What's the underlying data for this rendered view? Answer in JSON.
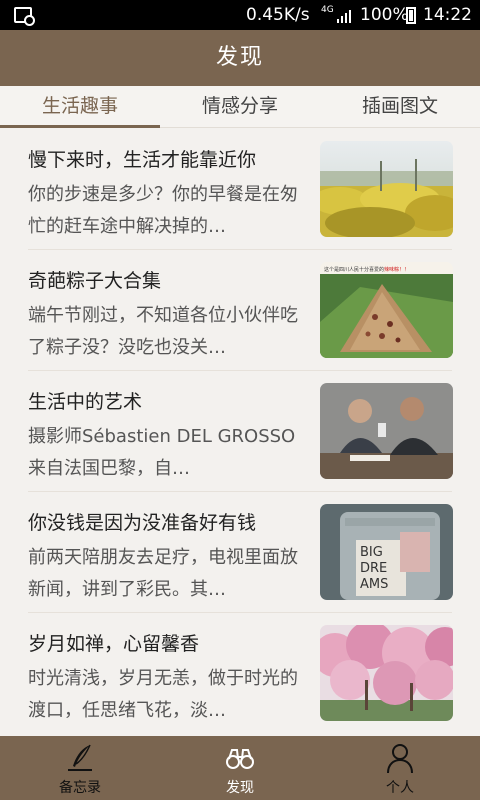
{
  "status_bar": {
    "speed": "0.45K/s",
    "network": "4G",
    "battery": "100%",
    "time": "14:22"
  },
  "header": {
    "title": "发现"
  },
  "tabs": [
    {
      "label": "生活趣事",
      "active": true
    },
    {
      "label": "情感分享",
      "active": false
    },
    {
      "label": "插画图文",
      "active": false
    }
  ],
  "articles": [
    {
      "title": "慢下来时，生活才能靠近你",
      "summary": "你的步速是多少？你的早餐是在匆忙的赶车途中解决掉的…",
      "image": "yellow-flower-field"
    },
    {
      "title": "奇葩粽子大合集",
      "summary": "端午节刚过，不知道各位小伙伴吃了粽子没？没吃也没关…",
      "image": "zongzi",
      "image_caption_prefix": "这个是四川人民十分喜爱的",
      "image_caption_highlight": "辣味粽！！"
    },
    {
      "title": "生活中的艺术",
      "summary": "摄影师Sébastien DEL GROSSO来自法国巴黎，自…",
      "image": "two-men-photo"
    },
    {
      "title": "你没钱是因为没准备好有钱",
      "summary": "前两天陪朋友去足疗，电视里面放新闻，讲到了彩民。其…",
      "image": "money-jar",
      "image_text": [
        "BIG",
        "DRE",
        "AMS"
      ]
    },
    {
      "title": "岁月如禅，心留馨香",
      "summary": "时光清浅，岁月无恙，做于时光的渡口，任思绪飞花，淡…",
      "image": "cherry-blossom"
    }
  ],
  "bottom_nav": [
    {
      "label": "备忘录",
      "icon": "quill-icon",
      "active": false
    },
    {
      "label": "发现",
      "icon": "binoculars-icon",
      "active": true
    },
    {
      "label": "个人",
      "icon": "person-icon",
      "active": false
    }
  ],
  "colors": {
    "accent": "#7a6550",
    "background": "#f3f1ee"
  }
}
